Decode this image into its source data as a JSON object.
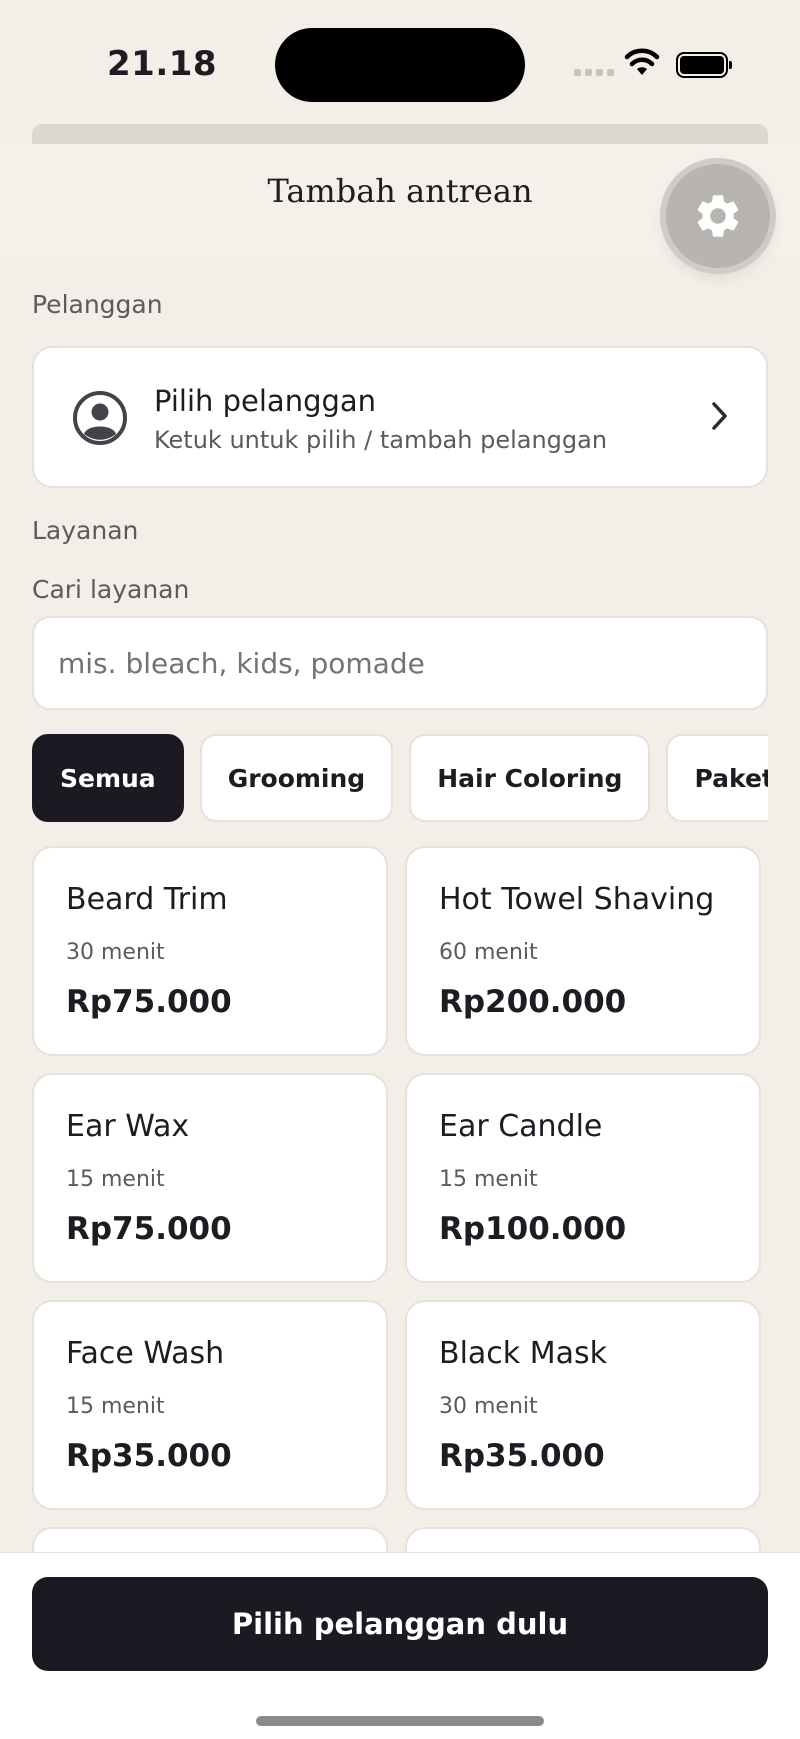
{
  "status_bar": {
    "time": "21.18"
  },
  "header": {
    "title": "Tambah antrean",
    "settings_icon": "gear-icon"
  },
  "customer": {
    "section_label": "Pelanggan",
    "card_title": "Pilih pelanggan",
    "card_subtitle": "Ketuk untuk pilih / tambah pelanggan",
    "icon": "user-circle-icon"
  },
  "services": {
    "section_label": "Layanan",
    "search_label": "Cari layanan",
    "search_placeholder": "mis. bleach, kids, pomade",
    "search_value": ""
  },
  "categories": [
    {
      "label": "Semua",
      "active": true
    },
    {
      "label": "Grooming",
      "active": false
    },
    {
      "label": "Hair Coloring",
      "active": false
    },
    {
      "label": "Paket",
      "active": false
    }
  ],
  "service_items": [
    {
      "name": "Beard Trim",
      "duration": "30 menit",
      "price": "Rp75.000"
    },
    {
      "name": "Hot Towel Shaving",
      "duration": "60 menit",
      "price": "Rp200.000"
    },
    {
      "name": "Ear Wax",
      "duration": "15 menit",
      "price": "Rp75.000"
    },
    {
      "name": "Ear Candle",
      "duration": "15 menit",
      "price": "Rp100.000"
    },
    {
      "name": "Face Wash",
      "duration": "15 menit",
      "price": "Rp35.000"
    },
    {
      "name": "Black Mask",
      "duration": "30 menit",
      "price": "Rp35.000"
    }
  ],
  "footer": {
    "cta_label": "Pilih pelanggan dulu"
  },
  "colors": {
    "background": "#f3eee7",
    "primary_dark": "#1b1a23",
    "card": "#ffffff"
  }
}
